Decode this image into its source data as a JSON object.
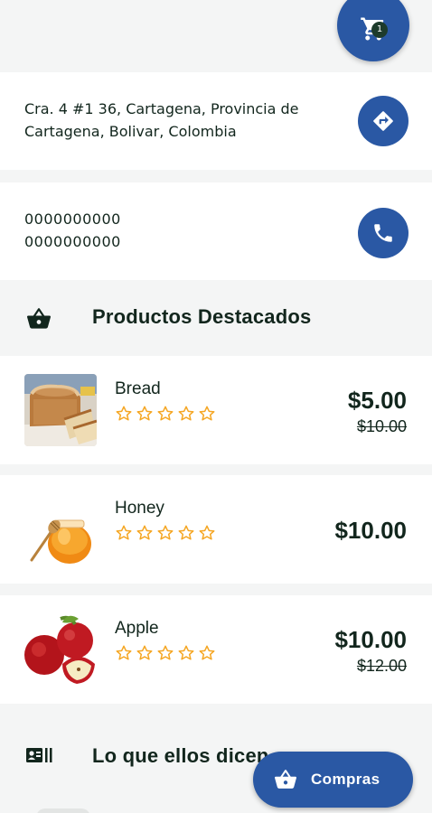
{
  "cart": {
    "count": "1",
    "icon": "cart-icon"
  },
  "store": {
    "address": "Cra. 4 #1 36, Cartagena, Provincia de Cartagena, Bolivar, Colombia",
    "phones": [
      "0000000000",
      "0000000000"
    ],
    "directions_icon": "directions-icon",
    "phone_icon": "phone-icon"
  },
  "featured": {
    "title": "Productos Destacados",
    "icon": "basket-icon"
  },
  "products": [
    {
      "name": "Bread",
      "price": "$5.00",
      "old_price": "$10.00",
      "rating": 0
    },
    {
      "name": "Honey",
      "price": "$10.00",
      "old_price": "",
      "rating": 0
    },
    {
      "name": "Apple",
      "price": "$10.00",
      "old_price": "$12.00",
      "rating": 0
    }
  ],
  "testimonials": {
    "title": "Lo que ellos dicen",
    "icon": "reviews-icon"
  },
  "shop_button": {
    "label": "Compras",
    "icon": "basket-icon"
  },
  "colors": {
    "primary": "#2a58a4",
    "text": "#12261d",
    "star": "#f5a623",
    "background": "#f4f5f5"
  }
}
